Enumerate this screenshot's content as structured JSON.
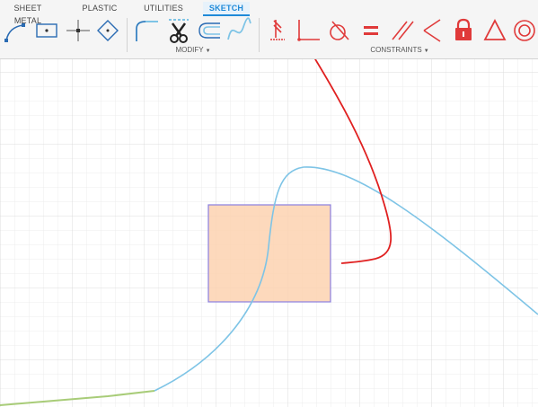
{
  "ribbon": {
    "tabs": [
      {
        "label": "SHEET METAL",
        "active": false
      },
      {
        "label": "PLASTIC",
        "active": false
      },
      {
        "label": "UTILITIES",
        "active": false
      },
      {
        "label": "SKETCH",
        "active": true
      }
    ],
    "groups": {
      "modify_label": "MODIFY",
      "constraints_label": "CONSTRAINTS"
    },
    "create_tools": [
      "arc-icon",
      "center-rectangle-icon",
      "point-icon",
      "polygon-icon"
    ],
    "modify_tools": [
      "fillet-icon",
      "trim-icon",
      "offset-icon",
      "spline-icon"
    ],
    "constraint_tools": [
      "fix-icon",
      "perpendicular-icon",
      "tangent-icon",
      "equal-icon",
      "parallel-icon",
      "coincident-icon",
      "lock-icon",
      "triangle-icon",
      "concentric-icon"
    ]
  },
  "colors": {
    "accent": "#1f8ad8",
    "constraint_red": "#e03a3a",
    "sketch_blue": "#7ec4e6",
    "sketch_green": "#a8cc78",
    "profile_fill": "#fdd2b0",
    "profile_edge": "#8a7fe0",
    "grid": "#e6e6e6"
  }
}
